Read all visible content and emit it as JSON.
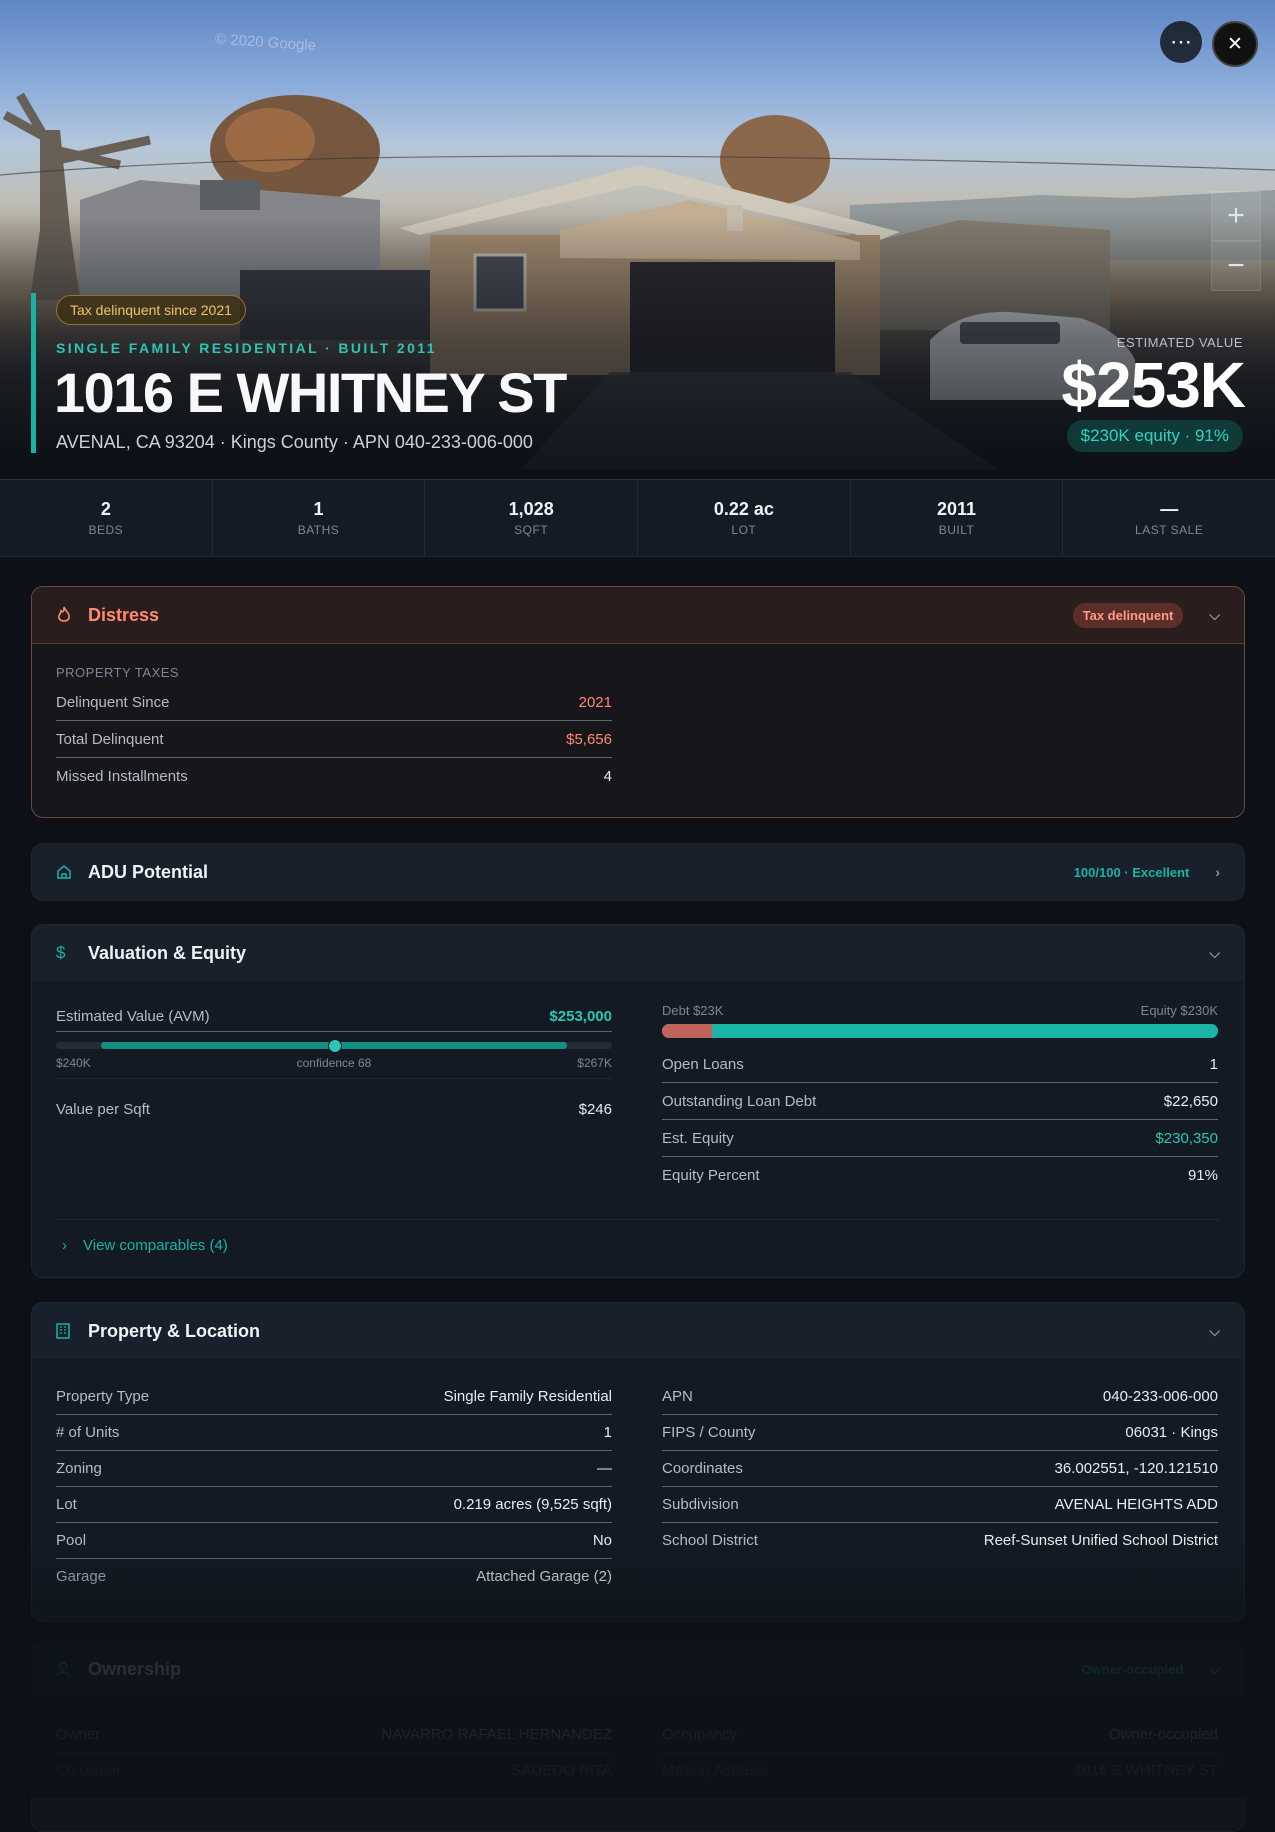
{
  "hero": {
    "tax_pill": "Tax delinquent since 2021",
    "subtitle": "SINGLE FAMILY RESIDENTIAL · BUILT 2011",
    "address": "1016 E WHITNEY ST",
    "address_line": "AVENAL, CA 93204 · Kings County · APN 040-233-006-000",
    "est_label": "ESTIMATED VALUE",
    "est_value": "$253K",
    "equity_pill": "$230K equity · 91%",
    "watermark": "© 2020 Google",
    "more_icon": "⋯",
    "close_icon": "✕",
    "zoom_in": "+",
    "zoom_out": "−"
  },
  "stats": [
    {
      "value": "2",
      "label": "BEDS"
    },
    {
      "value": "1",
      "label": "BATHS"
    },
    {
      "value": "1,028",
      "label": "SQFT"
    },
    {
      "value": "0.22 ac",
      "label": "LOT"
    },
    {
      "value": "2011",
      "label": "BUILT"
    },
    {
      "value": "—",
      "label": "LAST SALE"
    }
  ],
  "distress": {
    "title": "Distress",
    "badge": "Tax delinquent",
    "section": "PROPERTY TAXES",
    "rows": [
      {
        "label": "Delinquent Since",
        "value": "2021"
      },
      {
        "label": "Total Delinquent",
        "value": "$5,656"
      },
      {
        "label": "Missed Installments",
        "value": "4"
      }
    ]
  },
  "adu": {
    "title": "ADU Potential",
    "score": "100/100 · Excellent"
  },
  "valuation": {
    "title": "Valuation & Equity",
    "avm_label": "Estimated Value (AVM)",
    "avm_value": "$253,000",
    "range_low": "$240K",
    "confidence": "confidence 68",
    "range_high": "$267K",
    "range_fraction": 0.5,
    "vps_label": "Value per Sqft",
    "vps_value": "$246",
    "debt_label": "Debt $23K",
    "equity_label": "Equity $230K",
    "debt_fraction": 0.09,
    "rows": [
      {
        "label": "Open Loans",
        "value": "1"
      },
      {
        "label": "Outstanding Loan Debt",
        "value": "$22,650"
      },
      {
        "label": "Est. Equity",
        "value": "$230,350"
      },
      {
        "label": "Equity Percent",
        "value": "91%"
      }
    ],
    "comparables": "View comparables (4)"
  },
  "property": {
    "title": "Property & Location",
    "left": [
      {
        "label": "Property Type",
        "value": "Single Family Residential"
      },
      {
        "label": "# of Units",
        "value": "1"
      },
      {
        "label": "Zoning",
        "value": "—"
      },
      {
        "label": "Lot",
        "value": "0.219 acres (9,525 sqft)"
      },
      {
        "label": "Pool",
        "value": "No"
      },
      {
        "label": "Garage",
        "value": "Attached Garage (2)"
      }
    ],
    "right": [
      {
        "label": "APN",
        "value": "040-233-006-000"
      },
      {
        "label": "FIPS / County",
        "value": "06031 · Kings"
      },
      {
        "label": "Coordinates",
        "value": "36.002551, -120.121510"
      },
      {
        "label": "Subdivision",
        "value": "AVENAL HEIGHTS ADD"
      },
      {
        "label": "School District",
        "value": "Reef-Sunset Unified School District"
      }
    ]
  },
  "ownership": {
    "title": "Ownership",
    "badge": "Owner-occupied",
    "left": [
      {
        "label": "Owner",
        "value": "NAVARRO RAFAEL HERNANDEZ"
      },
      {
        "label": "Co-owner",
        "value": "SAUEDO RITA"
      }
    ],
    "right": [
      {
        "label": "Occupancy",
        "value": "Owner-occupied"
      },
      {
        "label": "Mailing Address",
        "value": "1016 E WHITNEY ST"
      }
    ]
  },
  "colors": {
    "accent": "#19b3a3",
    "danger": "#ff8a6e",
    "warning": "#f2c26b",
    "debt": "#c0645a"
  }
}
